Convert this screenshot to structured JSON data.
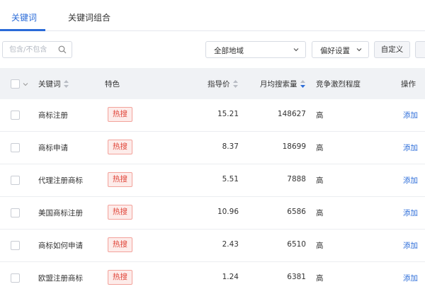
{
  "tabs": [
    {
      "label": "关键词"
    },
    {
      "label": "关键词组合"
    }
  ],
  "filters": {
    "keyword_placeholder": "包含/不包含",
    "region_select": "全部地域",
    "preference_select": "偏好设置",
    "custom_button": "自定义"
  },
  "table": {
    "headers": {
      "keyword": "关键词",
      "feature": "特色",
      "guide_price": "指导价",
      "monthly_searches": "月均搜索量",
      "competition": "竞争激烈程度",
      "action": "操作"
    },
    "rows": [
      {
        "keyword": "商标注册",
        "feature": "热搜",
        "price": "15.21",
        "searches": "148627",
        "competition": "高",
        "action": "添加"
      },
      {
        "keyword": "商标申请",
        "feature": "热搜",
        "price": "8.37",
        "searches": "18699",
        "competition": "高",
        "action": "添加"
      },
      {
        "keyword": "代理注册商标",
        "feature": "热搜",
        "price": "5.51",
        "searches": "7888",
        "competition": "高",
        "action": "添加"
      },
      {
        "keyword": "美国商标注册",
        "feature": "热搜",
        "price": "10.96",
        "searches": "6586",
        "competition": "高",
        "action": "添加"
      },
      {
        "keyword": "商标如何申请",
        "feature": "热搜",
        "price": "2.43",
        "searches": "6510",
        "competition": "高",
        "action": "添加"
      },
      {
        "keyword": "欧盟注册商标",
        "feature": "热搜",
        "price": "1.24",
        "searches": "6381",
        "competition": "高",
        "action": "添加"
      }
    ]
  },
  "colors": {
    "accent": "#2a6bd8",
    "badge_text": "#e0463a",
    "badge_bg": "#fdecea",
    "header_bg": "#f0f2f5"
  }
}
